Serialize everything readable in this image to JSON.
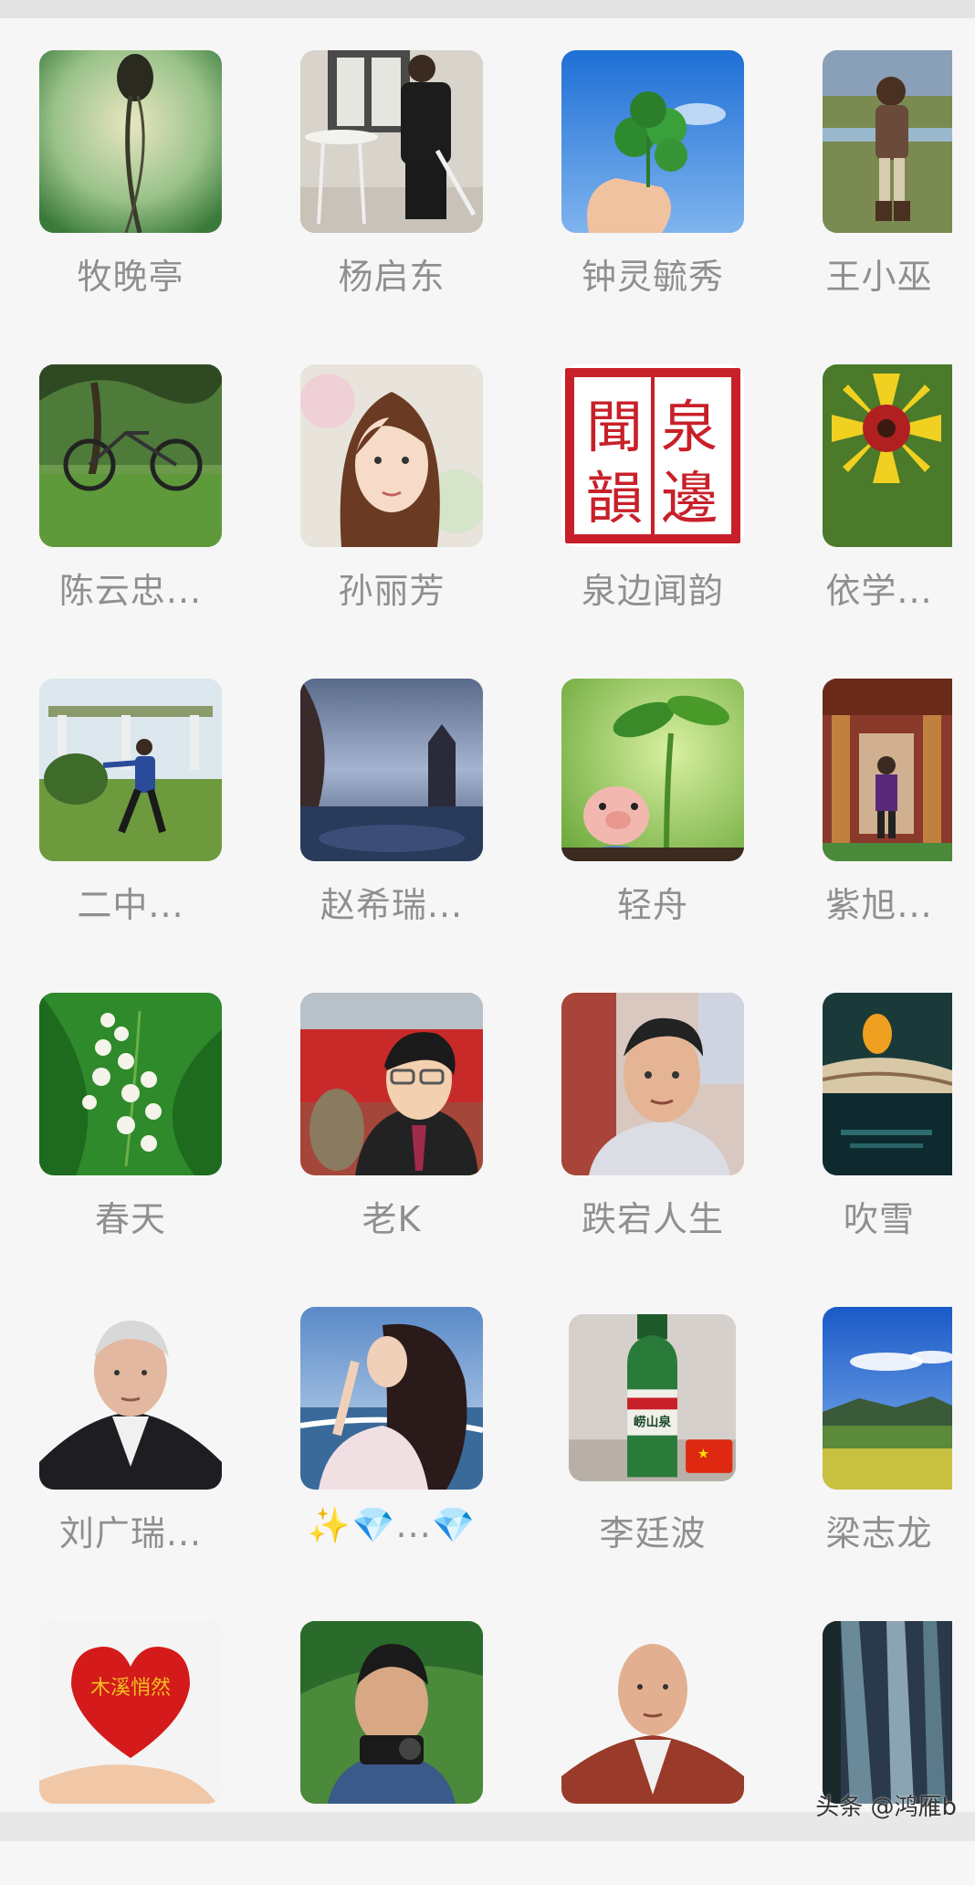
{
  "contacts": [
    {
      "name": "牧晚亭",
      "avatar": "green-blur"
    },
    {
      "name": "杨启东",
      "avatar": "man-seated"
    },
    {
      "name": "钟灵毓秀",
      "avatar": "clover-hand"
    },
    {
      "name": "王小巫",
      "avatar": "child-grassland"
    },
    {
      "name": "陈云忠...",
      "avatar": "bicycle-tree"
    },
    {
      "name": "孙丽芳",
      "avatar": "woman-portrait"
    },
    {
      "name": "泉边闻韵",
      "avatar": "seal-stamp"
    },
    {
      "name": "依学...",
      "avatar": "yellow-flower"
    },
    {
      "name": "二中...",
      "avatar": "man-garden"
    },
    {
      "name": "赵希瑞...",
      "avatar": "night-scene"
    },
    {
      "name": "轻舟",
      "avatar": "pig-sprout"
    },
    {
      "name": "紫旭...",
      "avatar": "temple-man"
    },
    {
      "name": "春天",
      "avatar": "lily-valley"
    },
    {
      "name": "老K",
      "avatar": "man-glasses"
    },
    {
      "name": "跌宕人生",
      "avatar": "older-man"
    },
    {
      "name": "吹雪",
      "avatar": "dark-scene"
    },
    {
      "name": "刘广瑞...",
      "avatar": "elder-portrait"
    },
    {
      "name": "✨💎...💎",
      "avatar": "girl-sea"
    },
    {
      "name": "李廷波",
      "avatar": "beer-bottle"
    },
    {
      "name": "梁志龙",
      "avatar": "landscape"
    },
    {
      "name": "",
      "avatar": "heart-hand"
    },
    {
      "name": "",
      "avatar": "man-camera"
    },
    {
      "name": "",
      "avatar": "bald-man"
    },
    {
      "name": "",
      "avatar": "waterfall"
    }
  ],
  "seal_text": "泉邊聞韻",
  "heart_text": "木溪悄然",
  "beer_label": "崂山泉",
  "watermark": "头条 @鸿雁b"
}
